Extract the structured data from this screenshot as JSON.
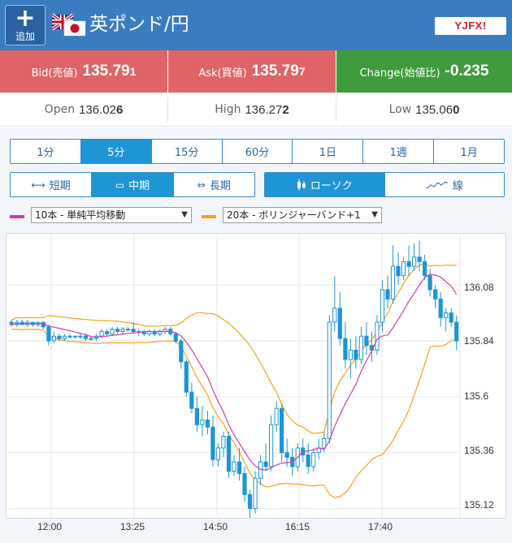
{
  "header": {
    "add_label": "追加",
    "title": "英ポンド/円",
    "logo_text": "YJFX!"
  },
  "prices": {
    "bid_label": "Bid(売値)",
    "bid_main": "135.79",
    "bid_tail": "1",
    "ask_label": "Ask(買値)",
    "ask_main": "135.79",
    "ask_tail": "7",
    "change_label": "Change(始値比)",
    "change_value": "-0.235",
    "bid_color": "#e06466",
    "change_color": "#3f9b3c"
  },
  "ohl": {
    "open_label": "Open",
    "open_main": "136.02",
    "open_tail": "6",
    "high_label": "High",
    "high_main": "136.27",
    "high_tail": "2",
    "low_label": "Low",
    "low_main": "135.06",
    "low_tail": "0"
  },
  "timeframes": [
    {
      "label": "1分",
      "active": false
    },
    {
      "label": "5分",
      "active": true
    },
    {
      "label": "15分",
      "active": false
    },
    {
      "label": "60分",
      "active": false
    },
    {
      "label": "1日",
      "active": false
    },
    {
      "label": "1週",
      "active": false
    },
    {
      "label": "1月",
      "active": false
    }
  ],
  "periods": [
    {
      "label": "短期",
      "icon": "short-term-icon",
      "active": false
    },
    {
      "label": "中期",
      "icon": "mid-term-icon",
      "active": true
    },
    {
      "label": "長期",
      "icon": "long-term-icon",
      "active": false
    }
  ],
  "chart_types": [
    {
      "label": "ローソク",
      "icon": "candlestick-icon",
      "active": true
    },
    {
      "label": "線",
      "icon": "line-chart-icon",
      "active": false
    }
  ],
  "indicators": {
    "ma_select": "10本 - 単純平均移動",
    "ma_color": "#cc3fa6",
    "bb_select": "20本 - ボリンジャーバンド+1",
    "bb_color": "#f2a21b"
  },
  "chart_data": {
    "type": "candlestick",
    "x_labels": [
      "12:00",
      "13:25",
      "14:50",
      "16:15",
      "17:40"
    ],
    "y_ticks": [
      "136.08",
      "135.84",
      "135.6",
      "135.36",
      "135.12"
    ],
    "ylim": [
      135.08,
      136.3
    ],
    "up_color": "#1e95d4",
    "ma_color": "#cc3fa6",
    "bb_color": "#f2a21b",
    "candles": [
      [
        135.92,
        135.93,
        135.9,
        135.91
      ],
      [
        135.91,
        135.93,
        135.9,
        135.92
      ],
      [
        135.92,
        135.93,
        135.91,
        135.91
      ],
      [
        135.91,
        135.93,
        135.9,
        135.92
      ],
      [
        135.92,
        135.92,
        135.9,
        135.91
      ],
      [
        135.91,
        135.92,
        135.9,
        135.92
      ],
      [
        135.92,
        135.92,
        135.89,
        135.9
      ],
      [
        135.9,
        135.91,
        135.82,
        135.84
      ],
      [
        135.84,
        135.88,
        135.83,
        135.86
      ],
      [
        135.86,
        135.87,
        135.84,
        135.85
      ],
      [
        135.85,
        135.87,
        135.84,
        135.86
      ],
      [
        135.86,
        135.87,
        135.85,
        135.86
      ],
      [
        135.86,
        135.86,
        135.85,
        135.86
      ],
      [
        135.86,
        135.87,
        135.85,
        135.86
      ],
      [
        135.86,
        135.87,
        135.84,
        135.85
      ],
      [
        135.85,
        135.86,
        135.84,
        135.85
      ],
      [
        135.85,
        135.87,
        135.84,
        135.86
      ],
      [
        135.86,
        135.89,
        135.85,
        135.88
      ],
      [
        135.88,
        135.89,
        135.86,
        135.87
      ],
      [
        135.87,
        135.9,
        135.86,
        135.89
      ],
      [
        135.89,
        135.9,
        135.87,
        135.88
      ],
      [
        135.88,
        135.9,
        135.87,
        135.89
      ],
      [
        135.89,
        135.9,
        135.88,
        135.89
      ],
      [
        135.89,
        135.92,
        135.87,
        135.88
      ],
      [
        135.88,
        135.89,
        135.86,
        135.88
      ],
      [
        135.88,
        135.89,
        135.86,
        135.87
      ],
      [
        135.87,
        135.89,
        135.86,
        135.88
      ],
      [
        135.88,
        135.89,
        135.86,
        135.87
      ],
      [
        135.87,
        135.89,
        135.86,
        135.88
      ],
      [
        135.88,
        135.9,
        135.87,
        135.89
      ],
      [
        135.89,
        135.9,
        135.86,
        135.87
      ],
      [
        135.87,
        135.88,
        135.83,
        135.84
      ],
      [
        135.84,
        135.85,
        135.72,
        135.75
      ],
      [
        135.75,
        135.76,
        135.6,
        135.62
      ],
      [
        135.62,
        135.66,
        135.53,
        135.55
      ],
      [
        135.55,
        135.6,
        135.45,
        135.48
      ],
      [
        135.48,
        135.56,
        135.43,
        135.5
      ],
      [
        135.5,
        135.54,
        135.44,
        135.47
      ],
      [
        135.47,
        135.52,
        135.3,
        135.33
      ],
      [
        135.33,
        135.4,
        135.3,
        135.38
      ],
      [
        135.38,
        135.45,
        135.34,
        135.43
      ],
      [
        135.43,
        135.45,
        135.25,
        135.28
      ],
      [
        135.28,
        135.35,
        135.26,
        135.32
      ],
      [
        135.32,
        135.38,
        135.24,
        135.27
      ],
      [
        135.27,
        135.3,
        135.15,
        135.18
      ],
      [
        135.18,
        135.2,
        135.08,
        135.12
      ],
      [
        135.12,
        135.28,
        135.1,
        135.25
      ],
      [
        135.25,
        135.35,
        135.22,
        135.32
      ],
      [
        135.32,
        135.4,
        135.28,
        135.3
      ],
      [
        135.3,
        135.52,
        135.28,
        135.48
      ],
      [
        135.48,
        135.58,
        135.45,
        135.55
      ],
      [
        135.55,
        135.57,
        135.32,
        135.36
      ],
      [
        135.36,
        135.42,
        135.3,
        135.34
      ],
      [
        135.34,
        135.38,
        135.26,
        135.3
      ],
      [
        135.3,
        135.4,
        135.28,
        135.38
      ],
      [
        135.38,
        135.42,
        135.32,
        135.35
      ],
      [
        135.35,
        135.4,
        135.27,
        135.3
      ],
      [
        135.3,
        135.38,
        135.28,
        135.36
      ],
      [
        135.36,
        135.42,
        135.33,
        135.38
      ],
      [
        135.38,
        135.45,
        135.36,
        135.42
      ],
      [
        135.42,
        135.95,
        135.4,
        135.92
      ],
      [
        135.92,
        136.12,
        135.88,
        135.98
      ],
      [
        135.98,
        136.05,
        135.82,
        135.85
      ],
      [
        135.85,
        135.92,
        135.72,
        135.76
      ],
      [
        135.76,
        135.85,
        135.68,
        135.8
      ],
      [
        135.8,
        135.86,
        135.72,
        135.76
      ],
      [
        135.76,
        135.9,
        135.74,
        135.86
      ],
      [
        135.86,
        135.92,
        135.78,
        135.82
      ],
      [
        135.82,
        135.88,
        135.75,
        135.8
      ],
      [
        135.8,
        135.95,
        135.78,
        135.92
      ],
      [
        135.92,
        136.1,
        135.88,
        136.06
      ],
      [
        136.06,
        136.12,
        135.98,
        136.02
      ],
      [
        136.02,
        136.25,
        136.0,
        136.16
      ],
      [
        136.16,
        136.22,
        136.08,
        136.12
      ],
      [
        136.12,
        136.2,
        136.1,
        136.18
      ],
      [
        136.18,
        136.25,
        136.12,
        136.16
      ],
      [
        136.16,
        136.26,
        136.14,
        136.2
      ],
      [
        136.2,
        136.27,
        136.14,
        136.18
      ],
      [
        136.18,
        136.21,
        136.1,
        136.12
      ],
      [
        136.12,
        136.15,
        136.03,
        136.06
      ],
      [
        136.06,
        136.08,
        135.98,
        136.02
      ],
      [
        136.02,
        136.05,
        135.9,
        135.94
      ],
      [
        135.94,
        135.98,
        135.88,
        135.96
      ],
      [
        135.96,
        135.98,
        135.9,
        135.92
      ],
      [
        135.92,
        135.95,
        135.8,
        135.84
      ]
    ]
  }
}
